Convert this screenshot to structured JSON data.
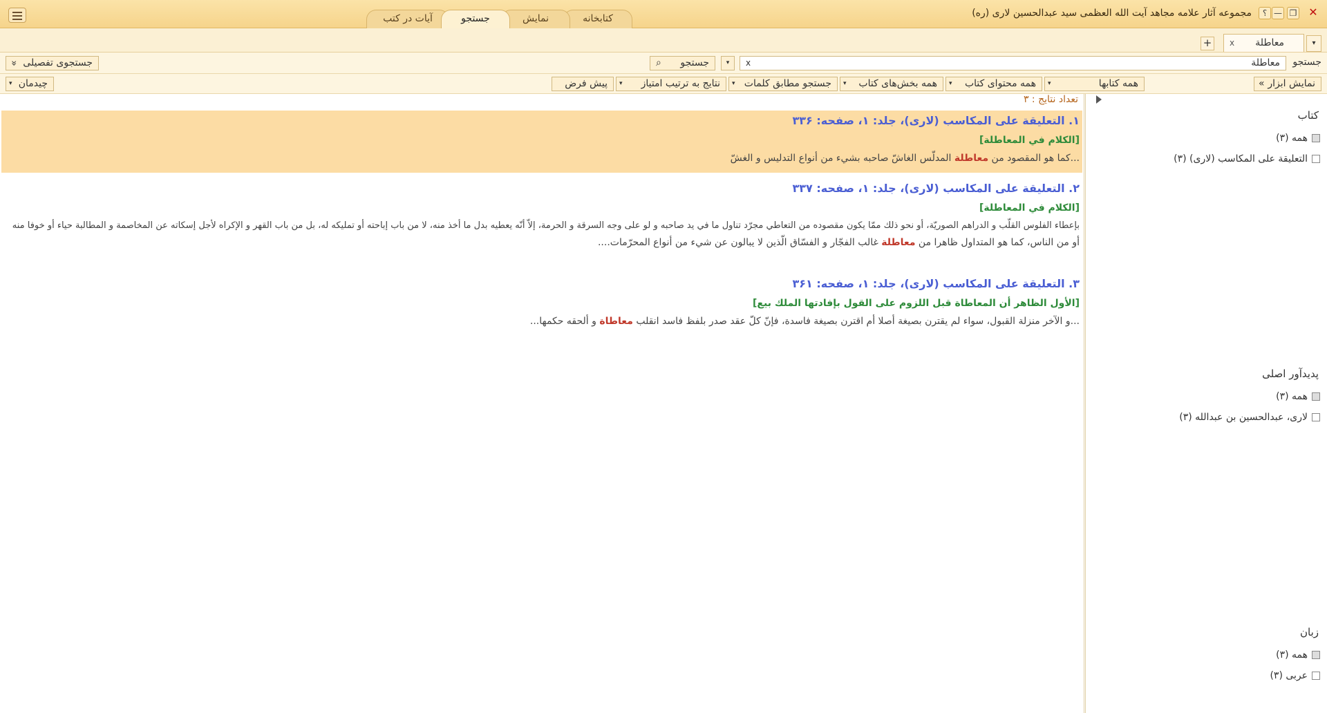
{
  "window": {
    "title": "مجموعه آثار علامه مجاهد آیت الله العظمی سید عبدالحسین لاری (ره)",
    "close_glyph": "✕",
    "minimize_glyph": "—",
    "restore_glyph": "❐",
    "help_glyph": "؟"
  },
  "main_tabs": [
    {
      "label": "کتابخانه"
    },
    {
      "label": "نمایش"
    },
    {
      "label": "جستجو"
    },
    {
      "label": "آیات در کتب"
    }
  ],
  "doc_tab": {
    "label": "معاطلة",
    "close": "x",
    "add": "+",
    "dropdown": "▾"
  },
  "search": {
    "label": "جستجو",
    "value": "معاطلة",
    "clear": "x",
    "button_label": "جستجو",
    "search_icon": "⌕",
    "advanced_label": "جستجوی تفصیلی",
    "advanced_icon": "»"
  },
  "toolbar": {
    "show_tools": "نمایش ابزار",
    "show_tools_icon": "«",
    "all_books": "همه کتابها",
    "all_content": "همه محتوای کتاب",
    "all_sections": "همه بخش‌های کتاب",
    "match_words": "جستجو مطابق کلمات",
    "sort": "نتایج به ترتیب امتیاز",
    "default": "پیش فرض",
    "layout": "چیدمان",
    "dropdown": "▾"
  },
  "results": {
    "count_label": "تعداد نتایج : ۳",
    "items": [
      {
        "title": "۱. التعلیقة علی المكاسب (لاری)، جلد: ۱، صفحه: ۳۳۶",
        "heading": "[الكلام في المعاطلة]",
        "lines": [
          {
            "before": "...كما هو المقصود من ",
            "hit": "معاطلة",
            "after": " المدلّس الغاشّ صاحبه بشيء من أنواع التدليس و الغشّ"
          }
        ]
      },
      {
        "title": "۲. التعلیقة علی المكاسب (لاری)، جلد: ۱، صفحه: ۳۳۷",
        "heading": "[الكلام في المعاطلة]",
        "lines": [
          {
            "before": "بإعطاء الفلوس القلّب و الدراهم الصوريّة، أو نحو ذلك ممّا يكون مقصوده من التعاطي مجرّد تناول ما في يد صاحبه و لو على وجه السرقة و الحرمة، إلاّ أنّه يعطيه بدل ما أخذ منه، لا من باب إباحته أو تمليكه له، بل من باب القهر و الإكراه لأجل إسكاته عن المخاصمة و المطالبة حياء أو خوفا منه",
            "hit": "",
            "after": ""
          },
          {
            "before": "أو من الناس، كما هو المتداول ظاهرا من ",
            "hit": "معاطلة",
            "after": " غالب الفجّار و الفسّاق الّذين لا يبالون عن شيء من أنواع المحرّمات...."
          }
        ]
      },
      {
        "title": "۳. التعلیقة علی المكاسب (لاری)، جلد: ۱، صفحه: ۳۶۱",
        "heading": "[الأول الظاهر أن المعاطاة قبل اللزوم على القول بإفادتها الملك بيع]",
        "lines": [
          {
            "before": "...و الآخر منزلة القبول، سواء لم يقترن بصيغة أصلا أم اقترن بصيغة فاسدة، فإنّ كلّ عقد صدر بلفظ فاسد انقلب ",
            "hit": "معاطاة",
            "after": " و ألحقه حكمها..."
          }
        ]
      }
    ]
  },
  "facets": {
    "book": {
      "title": "کتاب",
      "all": "همه (۳)",
      "options": [
        "التعلیقة علی المكاسب (لاری) (۳)"
      ]
    },
    "author": {
      "title": "پدیدآور اصلی",
      "all": "همه (۳)",
      "options": [
        "لاری، عبدالحسین بن عبدالله (۳)"
      ]
    },
    "language": {
      "title": "زبان",
      "all": "همه (۳)",
      "options": [
        "عربی (۳)"
      ]
    }
  }
}
